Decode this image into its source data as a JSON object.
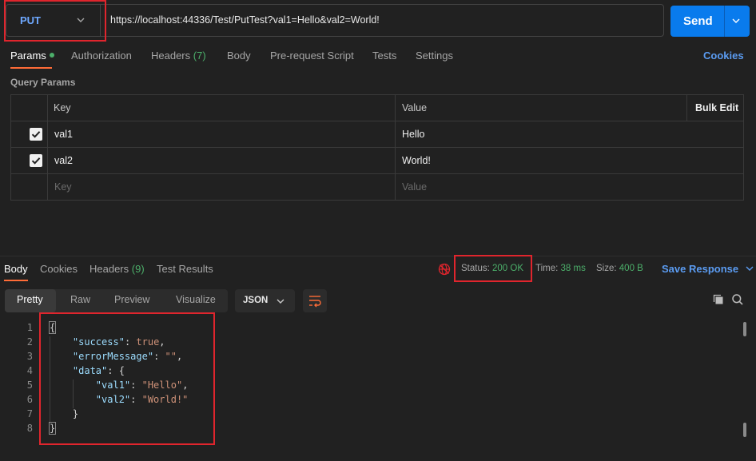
{
  "request": {
    "method": "PUT",
    "url": "https://localhost:44336/Test/PutTest?val1=Hello&val2=World!",
    "send_label": "Send"
  },
  "request_tabs": [
    {
      "label": "Params",
      "active": true
    },
    {
      "label": "Authorization"
    },
    {
      "label": "Headers",
      "count": "(7)"
    },
    {
      "label": "Body"
    },
    {
      "label": "Pre-request Script"
    },
    {
      "label": "Tests"
    },
    {
      "label": "Settings"
    }
  ],
  "cookies_label": "Cookies",
  "query_params": {
    "section_label": "Query Params",
    "headers": {
      "key": "Key",
      "value": "Value",
      "bulk_edit": "Bulk Edit"
    },
    "rows": [
      {
        "key": "val1",
        "value": "Hello",
        "checked": true
      },
      {
        "key": "val2",
        "value": "World!",
        "checked": true
      }
    ],
    "placeholder": {
      "key": "Key",
      "value": "Value"
    }
  },
  "response_tabs": [
    {
      "label": "Body",
      "active": true
    },
    {
      "label": "Cookies"
    },
    {
      "label": "Headers",
      "count": "(9)"
    },
    {
      "label": "Test Results"
    }
  ],
  "response_status": {
    "status_label": "Status:",
    "status_value": "200 OK",
    "time_label": "Time:",
    "time_value": "38 ms",
    "size_label": "Size:",
    "size_value": "400 B",
    "save_label": "Save Response"
  },
  "view_modes": [
    "Pretty",
    "Raw",
    "Preview",
    "Visualize"
  ],
  "format": "JSON",
  "code_lines": [
    {
      "n": "1",
      "text": "{"
    },
    {
      "n": "2",
      "text": "    \"success\": true,"
    },
    {
      "n": "3",
      "text": "    \"errorMessage\": \"\","
    },
    {
      "n": "4",
      "text": "    \"data\": {"
    },
    {
      "n": "5",
      "text": "        \"val1\": \"Hello\","
    },
    {
      "n": "6",
      "text": "        \"val2\": \"World!\""
    },
    {
      "n": "7",
      "text": "    }"
    },
    {
      "n": "8",
      "text": "}"
    }
  ],
  "colors": {
    "accent": "#ff6c37",
    "send": "#097bed",
    "success": "#4caf6a",
    "highlight": "#e0252d"
  }
}
